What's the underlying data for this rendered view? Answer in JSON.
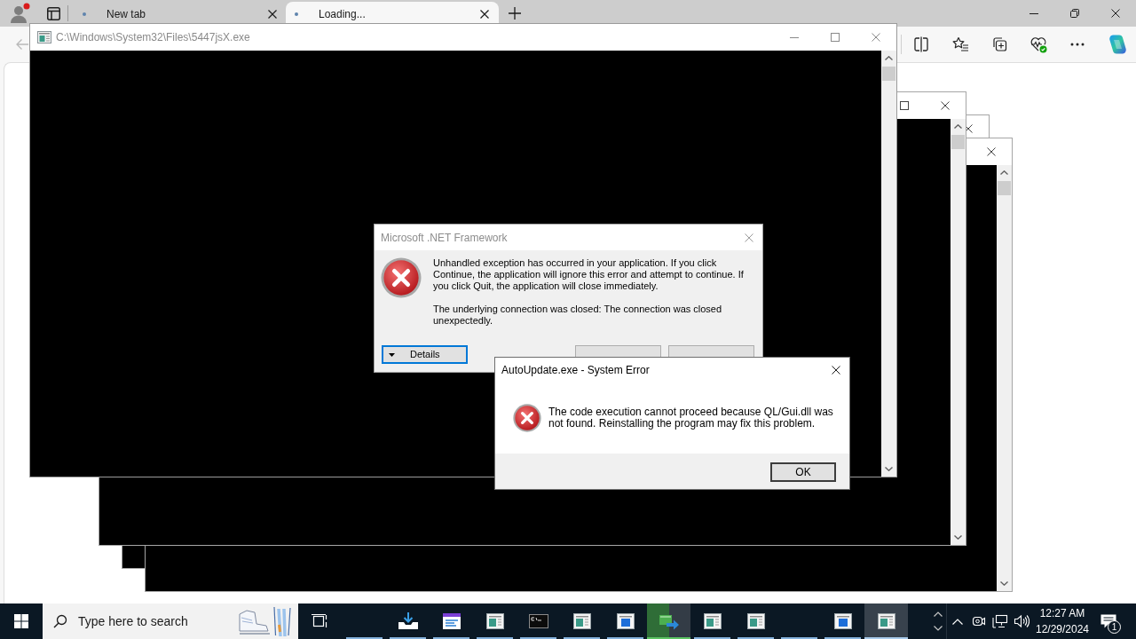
{
  "browser": {
    "tabs": [
      {
        "title": "New tab",
        "selected": false
      },
      {
        "title": "Loading...",
        "selected": true
      }
    ]
  },
  "console_window": {
    "title": "C:\\Windows\\System32\\Files\\5447jsX.exe"
  },
  "dotnet_dialog": {
    "title": "Microsoft .NET Framework",
    "message": "Unhandled exception has occurred in your application. If you click Continue, the application will ignore this error and attempt to continue. If you click Quit, the application will close immediately.",
    "detail": "The underlying connection was closed: The connection was closed unexpectedly.",
    "buttons": [
      {
        "label": "Details",
        "kind": "expander",
        "focused": true
      },
      {
        "kind": "push",
        "focused": false
      },
      {
        "kind": "push",
        "focused": false
      }
    ]
  },
  "error_dialog": {
    "title": "AutoUpdate.exe - System Error",
    "message": "The code execution cannot proceed because QL/Gui.dll was not found. Reinstalling the program may fix this problem.",
    "buttons": [
      {
        "label": "OK"
      }
    ]
  },
  "taskbar": {
    "search": {
      "placeholder": "Type here to search"
    },
    "apps": [
      {
        "kind": "none",
        "running": true
      },
      {
        "kind": "downloads",
        "running": true,
        "active": false
      },
      {
        "kind": "editor",
        "running": true,
        "active": false
      },
      {
        "kind": "window_teal",
        "running": true,
        "active": false
      },
      {
        "kind": "terminal",
        "running": true,
        "active": false
      },
      {
        "kind": "window_teal",
        "running": true,
        "active": false
      },
      {
        "kind": "window_blue",
        "running": true,
        "active": false
      },
      {
        "kind": "switch",
        "running": true,
        "active": false,
        "level": 0.5
      },
      {
        "kind": "window_teal",
        "running": true,
        "active": false
      },
      {
        "kind": "window_teal",
        "running": true,
        "active": false
      },
      {
        "kind": "none",
        "running": true
      },
      {
        "kind": "window_blue",
        "running": true,
        "active": false
      },
      {
        "kind": "window_teal",
        "running": true,
        "active": true
      }
    ],
    "clock": {
      "time": "12:27 AM",
      "date": "12/29/2024"
    },
    "notifications": {
      "count": "1"
    }
  }
}
